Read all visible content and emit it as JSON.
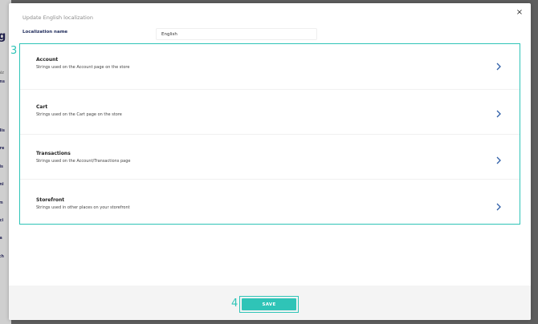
{
  "background": {
    "fragments": [
      "g",
      "miz",
      "ons",
      "ls",
      "glis",
      "bre",
      "kis",
      "ani",
      "rm",
      "nci",
      "lia",
      "tch"
    ]
  },
  "modal": {
    "title": "Update English localization",
    "close_glyph": "×",
    "field_label": "Localization name",
    "field_value": "English",
    "step3": "3",
    "step4": "4",
    "items": [
      {
        "title": "Account",
        "description": "Strings used on the Account page on the store"
      },
      {
        "title": "Cart",
        "description": "Strings used on the Cart page on the store"
      },
      {
        "title": "Transactions",
        "description": "Strings used on the Account/Transactions page"
      },
      {
        "title": "Storefront",
        "description": "Strings used in other places on your storefront"
      }
    ],
    "save_label": "SAVE"
  },
  "colors": {
    "accent": "#2fc4b7",
    "overlay": "#5e5e5e"
  }
}
